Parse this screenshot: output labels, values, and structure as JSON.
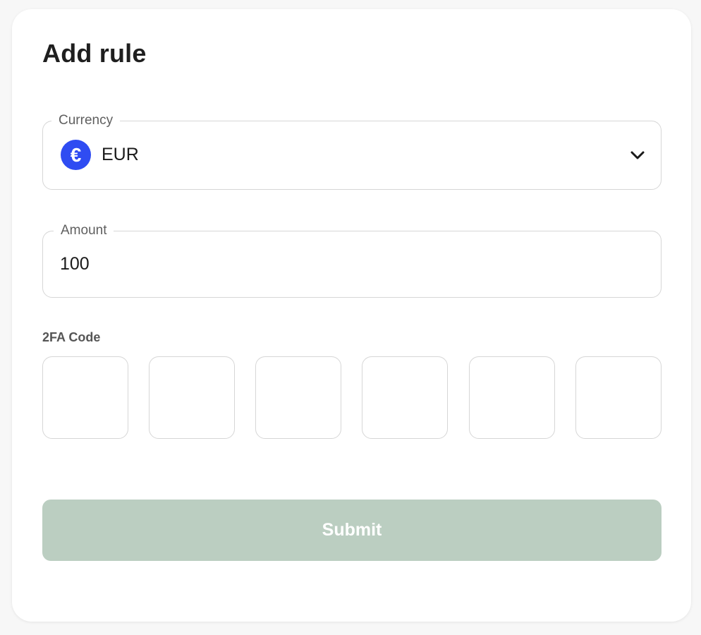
{
  "form": {
    "title": "Add rule",
    "currency": {
      "label": "Currency",
      "selected": "EUR",
      "icon": "euro-icon",
      "icon_glyph": "€",
      "icon_color": "#2f4cf2"
    },
    "amount": {
      "label": "Amount",
      "value": "100"
    },
    "tfa": {
      "label": "2FA Code",
      "digits": [
        "",
        "",
        "",
        "",
        "",
        ""
      ]
    },
    "submit": {
      "label": "Submit",
      "color": "#bbcec1",
      "disabled": true
    }
  }
}
